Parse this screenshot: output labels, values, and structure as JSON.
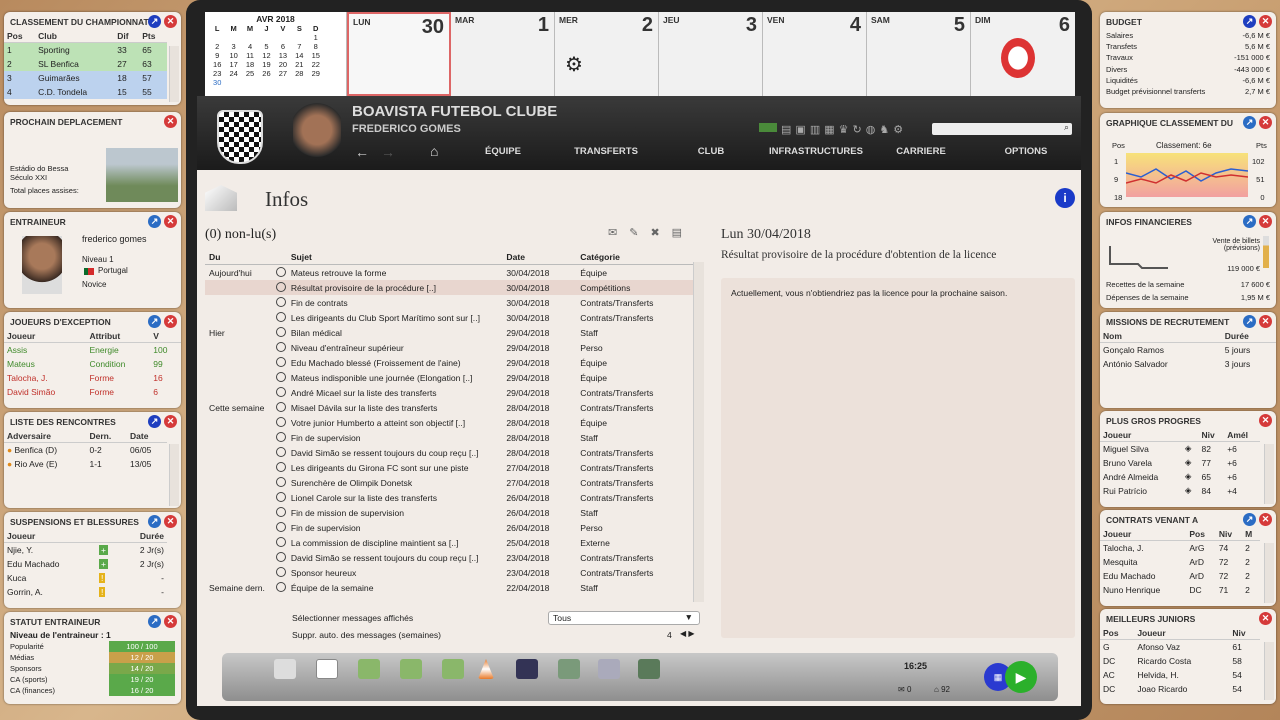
{
  "calendar": {
    "month": "AVR 2018",
    "weekday_headers": [
      "L",
      "M",
      "M",
      "J",
      "V",
      "S",
      "D"
    ],
    "weeks": [
      [
        "",
        "",
        "",
        "",
        "",
        "",
        "1"
      ],
      [
        "2",
        "3",
        "4",
        "5",
        "6",
        "7",
        "8"
      ],
      [
        "9",
        "10",
        "11",
        "12",
        "13",
        "14",
        "15"
      ],
      [
        "16",
        "17",
        "18",
        "19",
        "20",
        "21",
        "22"
      ],
      [
        "23",
        "24",
        "25",
        "26",
        "27",
        "28",
        "29"
      ],
      [
        "30",
        "",
        "",
        "",
        "",
        "",
        ""
      ]
    ],
    "days": [
      {
        "name": "LUN",
        "num": "30"
      },
      {
        "name": "MAR",
        "num": "1"
      },
      {
        "name": "MER",
        "num": "2"
      },
      {
        "name": "JEU",
        "num": "3"
      },
      {
        "name": "VEN",
        "num": "4"
      },
      {
        "name": "SAM",
        "num": "5"
      },
      {
        "name": "DIM",
        "num": "6"
      }
    ]
  },
  "header": {
    "club": "BOAVISTA FUTEBOL CLUBE",
    "manager": "FREDERICO GOMES"
  },
  "menu": [
    "ÉQUIPE",
    "TRANSFERTS",
    "CLUB",
    "INFRASTRUCTURES",
    "CARRIERE",
    "OPTIONS"
  ],
  "infos": {
    "title": "Infos",
    "unread": "(0) non-lu(s)",
    "cols": [
      "Du",
      "Sujet",
      "Date",
      "Catégorie"
    ],
    "rows": [
      [
        "Aujourd'hui",
        "Mateus retrouve la forme",
        "30/04/2018",
        "Équipe"
      ],
      [
        "",
        "Résultat provisoire de la procédure [..]",
        "30/04/2018",
        "Compétitions"
      ],
      [
        "",
        "Fin de contrats",
        "30/04/2018",
        "Contrats/Transferts"
      ],
      [
        "",
        "Les dirigeants du Club Sport Marítimo sont sur [..]",
        "30/04/2018",
        "Contrats/Transferts"
      ],
      [
        "Hier",
        "Bilan médical",
        "29/04/2018",
        "Staff"
      ],
      [
        "",
        "Niveau d'entraîneur supérieur",
        "29/04/2018",
        "Perso"
      ],
      [
        "",
        "Edu Machado blessé (Froissement de l'aine)",
        "29/04/2018",
        "Équipe"
      ],
      [
        "",
        "Mateus indisponible une journée (Elongation [..]",
        "29/04/2018",
        "Équipe"
      ],
      [
        "",
        "André Micael sur la liste des transferts",
        "29/04/2018",
        "Contrats/Transferts"
      ],
      [
        "Cette semaine",
        "Misael Dávila sur la liste des transferts",
        "28/04/2018",
        "Contrats/Transferts"
      ],
      [
        "",
        "Votre junior Humberto a atteint son objectif [..]",
        "28/04/2018",
        "Équipe"
      ],
      [
        "",
        "Fin de supervision",
        "28/04/2018",
        "Staff"
      ],
      [
        "",
        "David Simão se ressent toujours du coup reçu [..]",
        "28/04/2018",
        "Contrats/Transferts"
      ],
      [
        "",
        "Les dirigeants du Girona FC sont sur une piste",
        "27/04/2018",
        "Contrats/Transferts"
      ],
      [
        "",
        "Surenchère de Olimpik Donetsk",
        "27/04/2018",
        "Contrats/Transferts"
      ],
      [
        "",
        "Lionel Carole sur la liste des transferts",
        "26/04/2018",
        "Contrats/Transferts"
      ],
      [
        "",
        "Fin de mission de supervision",
        "26/04/2018",
        "Staff"
      ],
      [
        "",
        "Fin de supervision",
        "26/04/2018",
        "Perso"
      ],
      [
        "",
        "La commission de discipline maintient sa [..]",
        "25/04/2018",
        "Externe"
      ],
      [
        "",
        "David Simão se ressent toujours du coup reçu [..]",
        "23/04/2018",
        "Contrats/Transferts"
      ],
      [
        "",
        "Sponsor heureux",
        "23/04/2018",
        "Contrats/Transferts"
      ],
      [
        "Semaine dern.",
        "Équipe de la semaine",
        "22/04/2018",
        "Staff"
      ]
    ],
    "select_label": "Sélectionner messages affichés",
    "select_value": "Tous",
    "auto_label": "Suppr. auto. des messages (semaines)",
    "auto_value": "4",
    "detail_date": "Lun 30/04/2018",
    "detail_title": "Résultat provisoire de la procédure d'obtention de la licence",
    "detail_body": "Actuellement, vous n'obtiendriez pas la licence pour la prochaine saison."
  },
  "dock": {
    "time": "16:25",
    "mail": "0",
    "count": "92"
  },
  "classement": {
    "title": "CLASSEMENT DU CHAMPIONNAT",
    "cols": [
      "Pos",
      "Club",
      "Dif",
      "Pts"
    ],
    "rows": [
      [
        "1",
        "Sporting",
        "33",
        "65"
      ],
      [
        "2",
        "SL Benfica",
        "27",
        "63"
      ],
      [
        "3",
        "Guimarães",
        "18",
        "57"
      ],
      [
        "4",
        "C.D. Tondela",
        "15",
        "55"
      ]
    ]
  },
  "deplacement": {
    "title": "PROCHAIN DEPLACEMENT",
    "stadium": "Estádio do Bessa Século XXI",
    "places": "Total places assises:"
  },
  "entraineur": {
    "title": "ENTRAINEUR",
    "name": "frederico gomes",
    "level": "Niveau 1",
    "country": "Portugal",
    "grade": "Novice"
  },
  "exception": {
    "title": "JOUEURS D'EXCEPTION",
    "cols": [
      "Joueur",
      "Attribut",
      "V"
    ],
    "rows": [
      [
        "Assis",
        "Energie",
        "100"
      ],
      [
        "Mateus",
        "Condition",
        "99"
      ],
      [
        "Talocha, J.",
        "Forme",
        "16"
      ],
      [
        "David Simão",
        "Forme",
        "6"
      ]
    ]
  },
  "rencontres": {
    "title": "LISTE DES RENCONTRES",
    "cols": [
      "Adversaire",
      "Dern.",
      "Date"
    ],
    "rows": [
      [
        "Benfica (D)",
        "0-2",
        "06/05"
      ],
      [
        "Rio Ave (E)",
        "1-1",
        "13/05"
      ]
    ]
  },
  "blessures": {
    "title": "SUSPENSIONS ET BLESSURES",
    "cols": [
      "Joueur",
      "Durée"
    ],
    "rows": [
      [
        "Njie, Y.",
        "2 Jr(s)"
      ],
      [
        "Edu Machado",
        "2 Jr(s)"
      ],
      [
        "Kuca",
        "-"
      ],
      [
        "Gorrin, A.",
        "-"
      ]
    ]
  },
  "statut": {
    "title": "STATUT ENTRAINEUR",
    "level": "Niveau de l'entraineur : 1",
    "rows": [
      [
        "Popularité",
        "100 / 100"
      ],
      [
        "Médias",
        "12 / 20"
      ],
      [
        "Sponsors",
        "14 / 20"
      ],
      [
        "CA (sports)",
        "19 / 20"
      ],
      [
        "CA (finances)",
        "16 / 20"
      ]
    ]
  },
  "budget": {
    "title": "BUDGET",
    "rows": [
      [
        "Salaires",
        "-6,6 M €"
      ],
      [
        "Transfets",
        "5,6 M €"
      ],
      [
        "Travaux",
        "-151 000 €"
      ],
      [
        "Divers",
        "-443 000 €"
      ],
      [
        "Liquidités",
        "-6,6 M €"
      ],
      [
        "Budget prévisionnel transferts",
        "2,7 M €"
      ]
    ]
  },
  "graph": {
    "title": "GRAPHIQUE CLASSEMENT DU",
    "label": "Classement: 6e",
    "pos": "Pos",
    "pts": "Pts",
    "left": [
      "1",
      "9",
      "18"
    ],
    "right": [
      "102",
      "51",
      "0"
    ]
  },
  "financieres": {
    "title": "INFOS FINANCIERES",
    "note": "Vente de billets (prévisions)",
    "amount": "119 000 €",
    "r1": "Recettes de la semaine",
    "v1": "17 600 €",
    "r2": "Dépenses de la semaine",
    "v2": "1,95 M €"
  },
  "missions": {
    "title": "MISSIONS DE RECRUTEMENT",
    "cols": [
      "Nom",
      "Durée"
    ],
    "rows": [
      [
        "Gonçalo Ramos",
        "5 jours"
      ],
      [
        "António Salvador",
        "3 jours"
      ]
    ]
  },
  "progres": {
    "title": "PLUS GROS PROGRES",
    "cols": [
      "Joueur",
      "Niv",
      "Amél"
    ],
    "rows": [
      [
        "Miguel Silva",
        "82",
        "+6"
      ],
      [
        "Bruno Varela",
        "77",
        "+6"
      ],
      [
        "André Almeida",
        "65",
        "+6"
      ],
      [
        "Rui Patrício",
        "84",
        "+4"
      ]
    ]
  },
  "contrats": {
    "title": "CONTRATS VENANT A",
    "cols": [
      "Joueur",
      "Pos",
      "Niv",
      "M"
    ],
    "rows": [
      [
        "Talocha, J.",
        "ArG",
        "74",
        "2"
      ],
      [
        "Mesquita",
        "ArD",
        "72",
        "2"
      ],
      [
        "Edu Machado",
        "ArD",
        "72",
        "2"
      ],
      [
        "Nuno Henrique",
        "DC",
        "71",
        "2"
      ]
    ]
  },
  "juniors": {
    "title": "MEILLEURS JUNIORS",
    "cols": [
      "Pos",
      "Joueur",
      "Niv"
    ],
    "rows": [
      [
        "G",
        "Afonso Vaz",
        "61"
      ],
      [
        "DC",
        "Ricardo Costa",
        "58"
      ],
      [
        "AC",
        "Helvida, H.",
        "54"
      ],
      [
        "DC",
        "Joao Ricardo",
        "54"
      ]
    ]
  }
}
